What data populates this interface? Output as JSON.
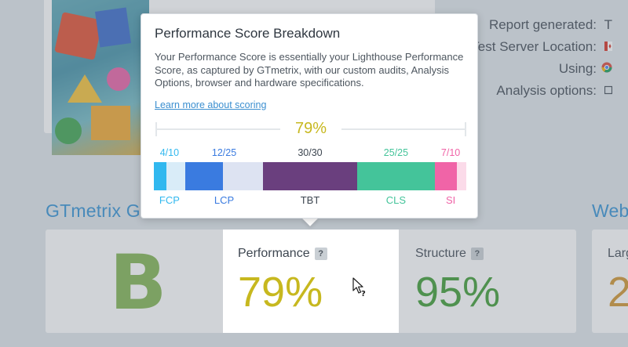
{
  "report": {
    "rows": [
      {
        "label": "Report generated:",
        "value": "T"
      },
      {
        "label": "Test Server Location:",
        "value": ""
      },
      {
        "label": "Using:",
        "value": ""
      },
      {
        "label": "Analysis options:",
        "value": ""
      }
    ]
  },
  "sections": {
    "grade_title": "GTmetrix G",
    "web_title": "Web"
  },
  "grade": {
    "letter": "B",
    "performance_label": "Performance",
    "performance_value": "79%",
    "structure_label": "Structure",
    "structure_value": "95%",
    "lcp_partial_label": "Larg",
    "lcp_partial_value": "2",
    "help_glyph": "?"
  },
  "popover": {
    "title": "Performance Score Breakdown",
    "description": "Your Performance Score is essentially your Lighthouse Performance Score, as captured by GTmetrix, with our custom audits, Analysis Options, browser and hardware specifications.",
    "link": "Learn more about scoring",
    "score": "79%",
    "segments": [
      {
        "name": "FCP",
        "score": "4/10",
        "achieved": 4,
        "max": 10,
        "color": "#31b8ef",
        "track": "#d9ecf8"
      },
      {
        "name": "LCP",
        "score": "12/25",
        "achieved": 12,
        "max": 25,
        "color": "#3a7be0",
        "track": "#dde3f2"
      },
      {
        "name": "TBT",
        "score": "30/30",
        "achieved": 30,
        "max": 30,
        "color": "#6a3f7e",
        "track": "#e6dfea"
      },
      {
        "name": "CLS",
        "score": "25/25",
        "achieved": 25,
        "max": 25,
        "color": "#44c49a",
        "track": "#d9f1e8"
      },
      {
        "name": "SI",
        "score": "7/10",
        "achieved": 7,
        "max": 10,
        "color": "#f064a7",
        "track": "#fbdbe9"
      }
    ]
  },
  "colors": {
    "accent_blue": "#2f8fd3",
    "performance": "#c7b81f",
    "structure": "#3a9a2f",
    "grade_b": "#7fb24d"
  },
  "icons": {
    "cursor": "help-cursor-icon",
    "flag": "canada-flag-icon",
    "browser": "chrome-icon",
    "options": "checkbox-icon"
  }
}
